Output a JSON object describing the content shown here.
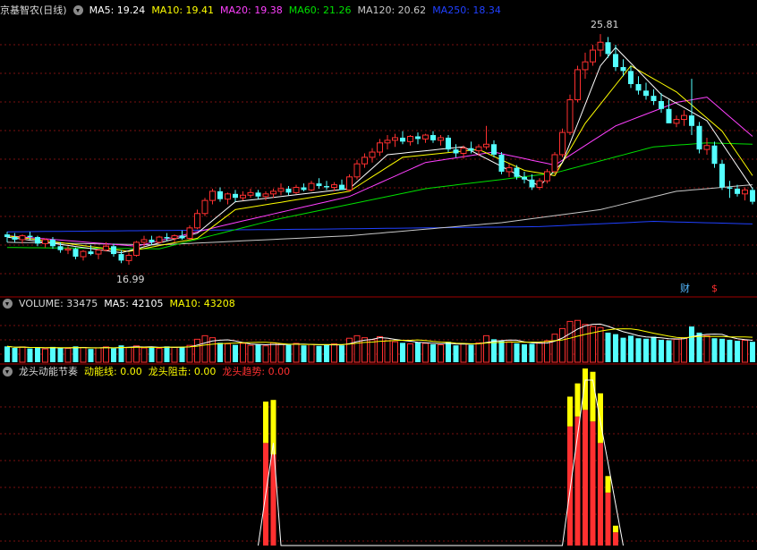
{
  "stock": {
    "name": "京基智农(日线)",
    "ma": [
      {
        "label": "MA5: 19.24",
        "color": "#ffffff"
      },
      {
        "label": "MA10: 19.41",
        "color": "#ffff00"
      },
      {
        "label": "MA20: 19.38",
        "color": "#ff40ff"
      },
      {
        "label": "MA60: 21.26",
        "color": "#00e000"
      },
      {
        "label": "MA120: 20.62",
        "color": "#c8c8c8"
      },
      {
        "label": "MA250: 18.34",
        "color": "#2040ff"
      }
    ],
    "high_label": "25.81",
    "low_label": "16.99",
    "badge_cai": "财",
    "badge_dollar": "$"
  },
  "volume_panel": {
    "title": "VOLUME: 33475",
    "ma5": "MA5: 42105",
    "ma10": "MA10: 43208"
  },
  "indicator_panel": {
    "title": "龙头动能节奏",
    "line1": "动能线: 0.00",
    "line2": "龙头阻击: 0.00",
    "line3": "龙头趋势: 0.00"
  },
  "colors": {
    "up": "#ff3030",
    "down": "#54ffff",
    "grid": "#7a1010",
    "ma5": "#ffffff",
    "ma10": "#ffff00",
    "ma20": "#ff40ff",
    "ma60": "#00e000",
    "ma120": "#c8c8c8",
    "ma250": "#2040ff"
  },
  "chart_data": {
    "type": "candlestick",
    "price_range": [
      16.0,
      26.5
    ],
    "volume_max": 100000,
    "candles": [
      [
        18.15,
        18.25,
        17.85,
        18.05
      ],
      [
        18.05,
        18.2,
        17.85,
        17.95
      ],
      [
        17.95,
        18.15,
        17.8,
        18.1
      ],
      [
        18.1,
        18.25,
        17.95,
        18.05
      ],
      [
        18.05,
        18.1,
        17.7,
        17.8
      ],
      [
        17.8,
        18.0,
        17.65,
        17.95
      ],
      [
        17.95,
        18.05,
        17.6,
        17.7
      ],
      [
        17.7,
        17.85,
        17.45,
        17.55
      ],
      [
        17.55,
        17.7,
        17.4,
        17.6
      ],
      [
        17.6,
        17.65,
        17.2,
        17.3
      ],
      [
        17.3,
        17.55,
        17.15,
        17.5
      ],
      [
        17.5,
        17.75,
        17.35,
        17.4
      ],
      [
        17.4,
        17.6,
        17.2,
        17.55
      ],
      [
        17.55,
        17.85,
        17.5,
        17.7
      ],
      [
        17.7,
        17.8,
        17.3,
        17.4
      ],
      [
        17.4,
        17.55,
        17.05,
        17.15
      ],
      [
        17.15,
        17.45,
        16.99,
        17.35
      ],
      [
        17.35,
        17.9,
        17.3,
        17.85
      ],
      [
        17.85,
        18.1,
        17.7,
        17.95
      ],
      [
        17.95,
        18.1,
        17.75,
        17.85
      ],
      [
        17.85,
        18.1,
        17.8,
        18.05
      ],
      [
        18.05,
        18.2,
        17.9,
        18.0
      ],
      [
        18.0,
        18.15,
        17.85,
        18.1
      ],
      [
        18.1,
        18.3,
        17.95,
        18.0
      ],
      [
        18.0,
        18.5,
        17.95,
        18.4
      ],
      [
        18.4,
        19.1,
        18.35,
        18.95
      ],
      [
        18.95,
        19.55,
        18.85,
        19.45
      ],
      [
        19.45,
        19.9,
        19.3,
        19.8
      ],
      [
        19.8,
        19.95,
        19.4,
        19.5
      ],
      [
        19.5,
        19.75,
        19.3,
        19.7
      ],
      [
        19.7,
        19.85,
        19.4,
        19.55
      ],
      [
        19.55,
        19.8,
        19.45,
        19.65
      ],
      [
        19.65,
        19.9,
        19.55,
        19.75
      ],
      [
        19.75,
        19.85,
        19.5,
        19.6
      ],
      [
        19.6,
        19.8,
        19.45,
        19.7
      ],
      [
        19.7,
        19.9,
        19.55,
        19.8
      ],
      [
        19.8,
        20.1,
        19.65,
        19.9
      ],
      [
        19.9,
        20.0,
        19.65,
        19.75
      ],
      [
        19.75,
        20.05,
        19.7,
        19.95
      ],
      [
        19.95,
        20.1,
        19.8,
        19.85
      ],
      [
        19.85,
        20.2,
        19.8,
        20.1
      ],
      [
        20.1,
        20.3,
        19.9,
        20.0
      ],
      [
        20.0,
        20.2,
        19.85,
        19.95
      ],
      [
        19.95,
        20.15,
        19.8,
        20.05
      ],
      [
        20.05,
        20.25,
        19.9,
        19.85
      ],
      [
        19.85,
        20.45,
        19.8,
        20.35
      ],
      [
        20.35,
        21.0,
        20.25,
        20.85
      ],
      [
        20.85,
        21.25,
        20.7,
        21.1
      ],
      [
        21.1,
        21.45,
        20.9,
        21.3
      ],
      [
        21.3,
        21.8,
        21.15,
        21.65
      ],
      [
        21.65,
        21.95,
        21.4,
        21.75
      ],
      [
        21.75,
        22.0,
        21.5,
        21.85
      ],
      [
        21.85,
        22.1,
        21.6,
        21.7
      ],
      [
        21.7,
        21.95,
        21.55,
        21.9
      ],
      [
        21.9,
        22.05,
        21.6,
        21.8
      ],
      [
        21.8,
        22.0,
        21.65,
        21.95
      ],
      [
        21.95,
        22.1,
        21.65,
        21.75
      ],
      [
        21.75,
        21.95,
        21.55,
        21.85
      ],
      [
        21.85,
        21.95,
        21.3,
        21.4
      ],
      [
        21.4,
        21.6,
        21.1,
        21.25
      ],
      [
        21.25,
        21.55,
        21.05,
        21.45
      ],
      [
        21.45,
        21.7,
        21.25,
        21.35
      ],
      [
        21.35,
        21.6,
        21.15,
        21.5
      ],
      [
        21.5,
        22.3,
        21.4,
        21.6
      ],
      [
        21.6,
        21.75,
        21.1,
        21.2
      ],
      [
        21.2,
        21.3,
        20.45,
        20.55
      ],
      [
        20.55,
        20.85,
        20.35,
        20.7
      ],
      [
        20.7,
        20.8,
        20.25,
        20.35
      ],
      [
        20.35,
        20.55,
        20.1,
        20.25
      ],
      [
        20.25,
        20.45,
        19.85,
        19.95
      ],
      [
        19.95,
        20.3,
        19.85,
        20.2
      ],
      [
        20.2,
        20.65,
        20.1,
        20.55
      ],
      [
        20.55,
        21.3,
        20.45,
        21.2
      ],
      [
        21.2,
        22.2,
        21.1,
        22.05
      ],
      [
        22.05,
        23.5,
        21.95,
        23.3
      ],
      [
        23.3,
        24.6,
        23.2,
        24.45
      ],
      [
        24.45,
        25.1,
        24.1,
        24.75
      ],
      [
        24.75,
        25.4,
        24.6,
        25.2
      ],
      [
        25.2,
        25.81,
        24.95,
        25.5
      ],
      [
        25.5,
        25.7,
        24.9,
        25.05
      ],
      [
        25.05,
        25.4,
        24.4,
        24.55
      ],
      [
        24.55,
        24.85,
        24.2,
        24.4
      ],
      [
        24.4,
        24.6,
        23.75,
        23.9
      ],
      [
        23.9,
        24.2,
        23.5,
        23.65
      ],
      [
        23.65,
        23.95,
        23.3,
        23.45
      ],
      [
        23.45,
        23.7,
        23.1,
        23.25
      ],
      [
        23.25,
        23.55,
        22.8,
        22.95
      ],
      [
        22.95,
        23.3,
        22.65,
        22.4
      ],
      [
        22.4,
        22.7,
        22.25,
        22.55
      ],
      [
        22.55,
        22.9,
        22.3,
        22.7
      ],
      [
        22.7,
        24.1,
        21.95,
        22.3
      ],
      [
        22.3,
        22.45,
        21.25,
        21.4
      ],
      [
        21.4,
        21.85,
        21.2,
        21.55
      ],
      [
        21.55,
        21.7,
        20.7,
        20.85
      ],
      [
        20.85,
        21.0,
        19.85,
        19.95
      ],
      [
        19.95,
        20.2,
        19.55,
        19.9
      ],
      [
        19.9,
        20.05,
        19.6,
        19.7
      ],
      [
        19.7,
        19.95,
        19.45,
        19.85
      ],
      [
        19.85,
        19.95,
        19.3,
        19.4
      ]
    ],
    "volumes": [
      31000,
      28000,
      30000,
      27000,
      29000,
      26000,
      30000,
      28000,
      27000,
      31000,
      29000,
      26000,
      28000,
      30000,
      27000,
      33000,
      29000,
      32000,
      28000,
      30000,
      27000,
      31000,
      29000,
      30000,
      33000,
      45000,
      52000,
      48000,
      38000,
      36000,
      34000,
      37000,
      33000,
      35000,
      32000,
      38000,
      36000,
      34000,
      37000,
      33000,
      35000,
      32000,
      34000,
      36000,
      33000,
      47000,
      52000,
      48000,
      44000,
      50000,
      42000,
      40000,
      38000,
      36000,
      39000,
      37000,
      35000,
      34000,
      40000,
      33000,
      36000,
      34000,
      38000,
      52000,
      45000,
      42000,
      40000,
      37000,
      35000,
      36000,
      38000,
      42000,
      55000,
      66000,
      80000,
      82000,
      74000,
      70000,
      68000,
      58000,
      55000,
      48000,
      52000,
      47000,
      46000,
      50000,
      44000,
      43000,
      45000,
      48000,
      70000,
      58000,
      52000,
      47000,
      46000,
      44000,
      42000,
      43000,
      40000
    ],
    "ma_lines": {
      "ma5": [
        [
          0,
          18.05
        ],
        [
          15,
          17.45
        ],
        [
          25,
          18.2
        ],
        [
          30,
          19.4
        ],
        [
          45,
          19.9
        ],
        [
          50,
          21.2
        ],
        [
          60,
          21.5
        ],
        [
          66,
          20.6
        ],
        [
          70,
          20.0
        ],
        [
          73,
          20.9
        ],
        [
          78,
          24.6
        ],
        [
          80,
          25.3
        ],
        [
          86,
          23.5
        ],
        [
          92,
          22.5
        ],
        [
          98,
          19.9
        ]
      ],
      "ma10": [
        [
          0,
          18.1
        ],
        [
          16,
          17.5
        ],
        [
          25,
          18.0
        ],
        [
          30,
          19.1
        ],
        [
          45,
          19.8
        ],
        [
          52,
          21.1
        ],
        [
          62,
          21.4
        ],
        [
          68,
          20.6
        ],
        [
          72,
          20.4
        ],
        [
          76,
          22.4
        ],
        [
          82,
          24.6
        ],
        [
          88,
          23.6
        ],
        [
          94,
          22.1
        ],
        [
          98,
          20.4
        ]
      ],
      "ma20": [
        [
          0,
          18.1
        ],
        [
          17,
          17.7
        ],
        [
          30,
          18.6
        ],
        [
          45,
          19.6
        ],
        [
          55,
          20.9
        ],
        [
          64,
          21.3
        ],
        [
          72,
          20.8
        ],
        [
          80,
          22.3
        ],
        [
          88,
          23.2
        ],
        [
          92,
          23.4
        ],
        [
          98,
          21.9
        ]
      ],
      "ma60": [
        [
          0,
          17.65
        ],
        [
          20,
          17.6
        ],
        [
          35,
          18.7
        ],
        [
          55,
          19.9
        ],
        [
          72,
          20.5
        ],
        [
          85,
          21.5
        ],
        [
          92,
          21.65
        ],
        [
          98,
          21.6
        ]
      ],
      "ma120": [
        [
          0,
          17.85
        ],
        [
          20,
          17.75
        ],
        [
          45,
          18.1
        ],
        [
          65,
          18.6
        ],
        [
          78,
          19.1
        ],
        [
          88,
          19.8
        ],
        [
          98,
          20.05
        ]
      ],
      "ma250": [
        [
          0,
          18.25
        ],
        [
          40,
          18.35
        ],
        [
          70,
          18.45
        ],
        [
          85,
          18.65
        ],
        [
          98,
          18.55
        ]
      ]
    },
    "indicator": {
      "range": [
        0,
        1
      ],
      "bars": [
        {
          "i": 34,
          "v": 0.62,
          "y": 0.25
        },
        {
          "i": 35,
          "v": 0.55,
          "y": 0.33
        },
        {
          "i": 74,
          "v": 0.72,
          "y": 0.18
        },
        {
          "i": 75,
          "v": 0.78,
          "y": 0.2
        },
        {
          "i": 76,
          "v": 0.82,
          "y": 0.25
        },
        {
          "i": 77,
          "v": 0.75,
          "y": 0.3
        },
        {
          "i": 78,
          "v": 0.62,
          "y": 0.3
        },
        {
          "i": 79,
          "v": 0.32,
          "y": 0.1
        },
        {
          "i": 80,
          "v": 0.08,
          "y": 0.04
        }
      ],
      "trend": [
        [
          33,
          0.0
        ],
        [
          35,
          0.62
        ],
        [
          36,
          0.0
        ],
        [
          73,
          0.0
        ],
        [
          76,
          1.0
        ],
        [
          77,
          1.0
        ],
        [
          81,
          0.0
        ]
      ]
    }
  }
}
